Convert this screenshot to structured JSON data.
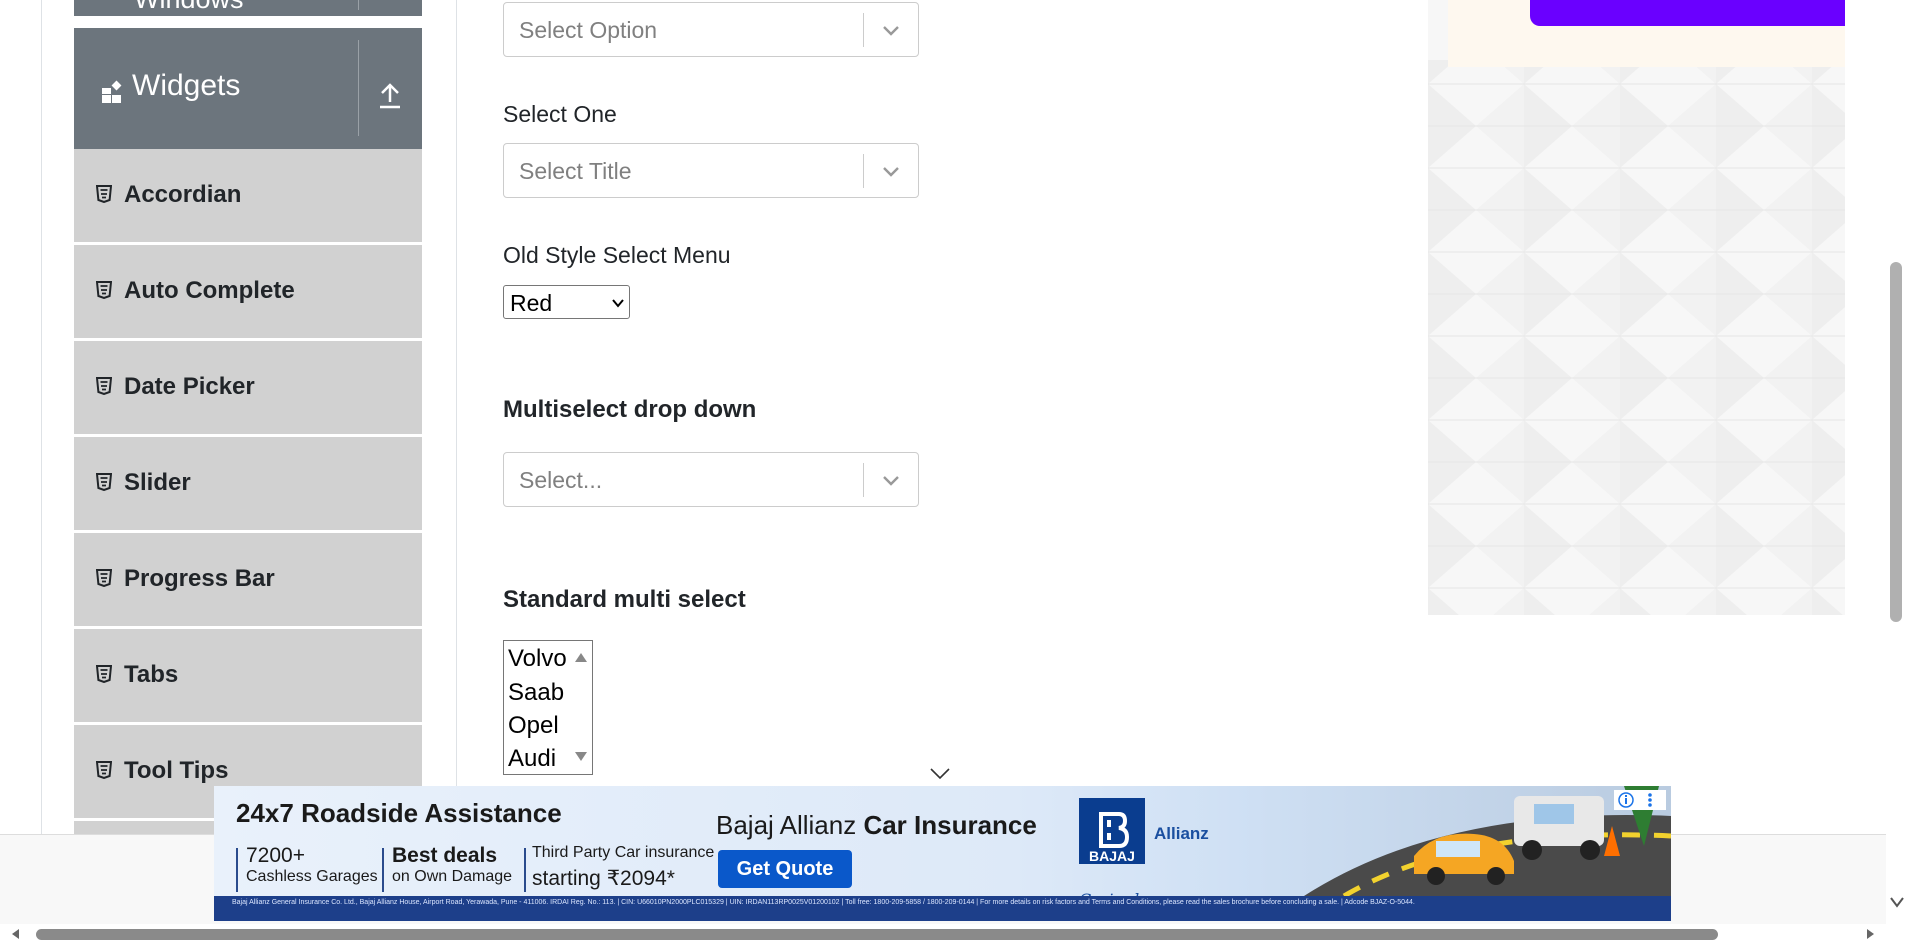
{
  "sidebar": {
    "prev_group_label": "Windows",
    "group": {
      "label": "Widgets"
    },
    "items": [
      {
        "label": "Accordian"
      },
      {
        "label": "Auto Complete"
      },
      {
        "label": "Date Picker"
      },
      {
        "label": "Slider"
      },
      {
        "label": "Progress Bar"
      },
      {
        "label": "Tabs"
      },
      {
        "label": "Tool Tips"
      }
    ]
  },
  "form": {
    "select_value": {
      "placeholder": "Select Option"
    },
    "select_one": {
      "label": "Select One",
      "placeholder": "Select Title"
    },
    "old_style": {
      "label": "Old Style Select Menu",
      "value": "Red"
    },
    "multiselect": {
      "label": "Multiselect drop down",
      "placeholder": "Select..."
    },
    "standard_multi": {
      "label": "Standard multi select",
      "options": [
        "Volvo",
        "Saab",
        "Opel",
        "Audi"
      ]
    }
  },
  "ad_banner": {
    "title": "24x7 Roadside Assistance",
    "stat1_big": "7200+",
    "stat1_small": "Cashless Garages",
    "stat2_big": "Best deals",
    "stat2_small": "on Own Damage",
    "stat3_line1": "Third Party Car insurance",
    "stat3_line2": "starting ₹2094*",
    "brand_prefix": "Bajaj Allianz",
    "brand_suffix": "Car Insurance",
    "cta": "Get Quote",
    "logo": "BAJAJ",
    "partner": "Allianz",
    "tagline": "Caringly yours",
    "fine_print": "Bajaj Allianz General Insurance Co. Ltd., Bajaj Allianz House, Airport Road, Yerawada, Pune - 411006. IRDAI Reg. No.: 113. | CIN: U66010PN2000PLC015329 | UIN: IRDAN113RP0025V01200102 | Toll free: 1800-209-5858 / 1800-209-0144 | For more details on risk factors and Terms and Conditions, please read the sales brochure before concluding a sale. | Adcode BJAZ-O-5044."
  },
  "colors": {
    "group_bg": "#6c757d",
    "item_bg": "#d1d1d1",
    "cta_bg": "#0a58ca",
    "ad_button": "#6a00ff"
  }
}
